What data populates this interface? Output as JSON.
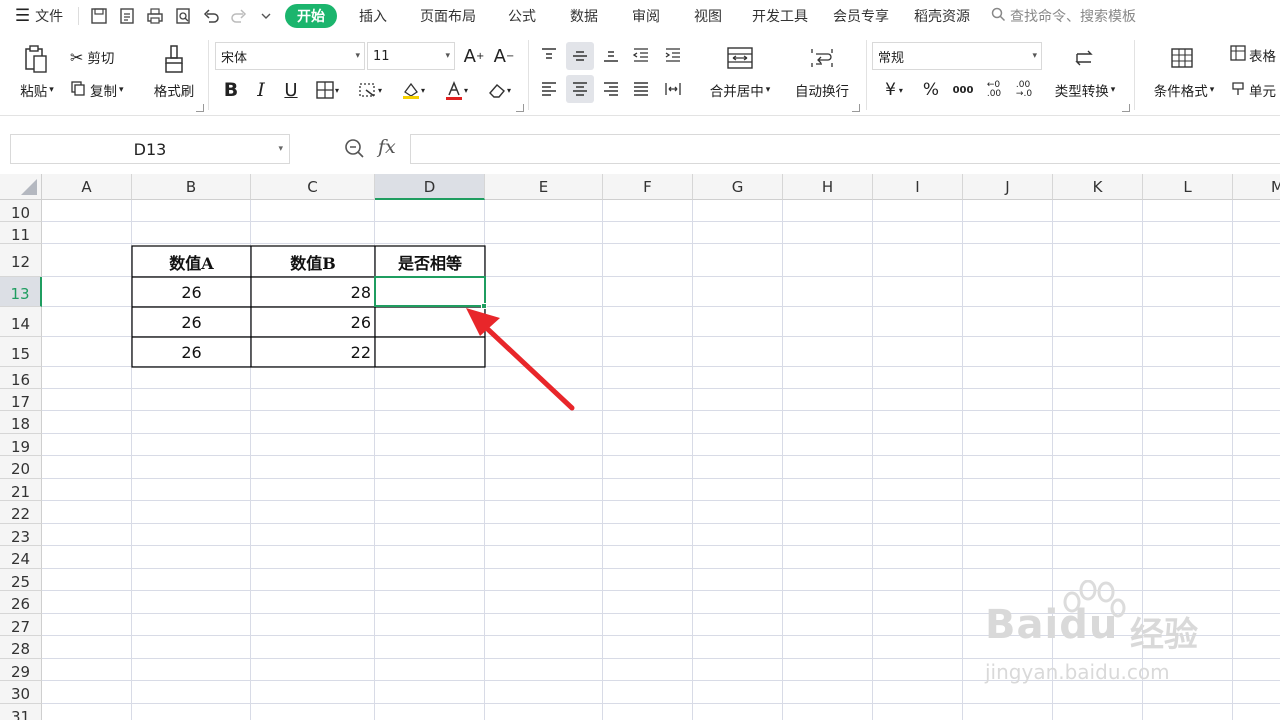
{
  "topbar": {
    "menu_label": "文件",
    "tabs": [
      "开始",
      "插入",
      "页面布局",
      "公式",
      "数据",
      "审阅",
      "视图",
      "开发工具",
      "会员专享",
      "稻壳资源"
    ],
    "active_tab": "开始",
    "search_placeholder": "查找命令、搜索模板",
    "accent": "#1bb56d"
  },
  "ribbon": {
    "paste": "粘贴",
    "cut": "剪切",
    "copy": "复制",
    "format_painter": "格式刷",
    "font_name": "宋体",
    "font_size": "11",
    "merge_center": "合并居中",
    "wrap_text": "自动换行",
    "number_format": "常规",
    "type_convert": "类型转换",
    "conditional_format": "条件格式",
    "table_style": "表格",
    "cell_style": "单元"
  },
  "formula_bar": {
    "name_box": "D13",
    "fx_label": "fx",
    "formula": ""
  },
  "columns": [
    "A",
    "B",
    "C",
    "D",
    "E",
    "F",
    "G",
    "H",
    "I",
    "J",
    "K",
    "L",
    "M"
  ],
  "rows": [
    "10",
    "11",
    "12",
    "13",
    "14",
    "15",
    "16",
    "17",
    "18",
    "19",
    "20",
    "21",
    "22",
    "23",
    "24",
    "25",
    "26",
    "27",
    "28",
    "29",
    "30",
    "31"
  ],
  "selected_cell": "D13",
  "table": {
    "headers": [
      "数值A",
      "数值B",
      "是否相等"
    ],
    "rows": [
      [
        "26",
        "28",
        ""
      ],
      [
        "26",
        "26",
        ""
      ],
      [
        "26",
        "22",
        ""
      ]
    ]
  },
  "watermark": {
    "brand": "Baidu",
    "product": "经验",
    "url": "jingyan.baidu.com"
  },
  "colors": {
    "selection_green": "#1f9d60",
    "arrow_red": "#e8262a"
  }
}
